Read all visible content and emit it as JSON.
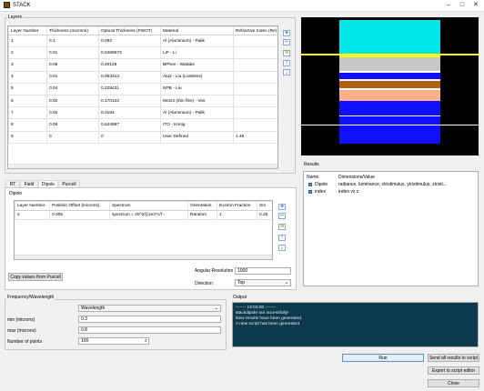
{
  "window": {
    "title": "STACK",
    "minimize_icon": "minimize-icon",
    "maximize_icon": "maximize-icon",
    "close_icon": "close-icon"
  },
  "layers": {
    "title": "Layers",
    "columns": [
      "Layer Number",
      "Thickness (microns)",
      "Optical Thickness (FWOT)",
      "Material",
      "Refractive Index (Re)"
    ],
    "rows": [
      [
        "1",
        "0.1",
        "0.092",
        "Al (Aluminium) - Palik",
        ""
      ],
      [
        "2",
        "0.01",
        "0.0469573",
        "LiF - Li",
        ""
      ],
      [
        "3",
        "0.06",
        "0.40128",
        "BPhen - Watabe",
        ""
      ],
      [
        "4",
        "0.01",
        "0.063313",
        "Alq3 - Liu (Lossless)",
        ""
      ],
      [
        "5",
        "0.04",
        "0.228431",
        "NPB - Liu",
        ""
      ],
      [
        "6",
        "0.02",
        "0.170122",
        "MoO3 (thin film) - Vos",
        ""
      ],
      [
        "7",
        "0.02",
        "0.0184",
        "Al (Aluminium) - Palik",
        ""
      ],
      [
        "8",
        "0.08",
        "0.624897",
        "ITO - Konig",
        ""
      ],
      [
        "9",
        "0",
        "0",
        "User Defined",
        "1.46"
      ]
    ]
  },
  "tabs": [
    {
      "label": "RT"
    },
    {
      "label": "Field"
    },
    {
      "label": "Dipole"
    },
    {
      "label": "Purcell"
    }
  ],
  "dipole": {
    "title": "Dipole",
    "columns": [
      "Layer Number",
      "Position Offset (microns)",
      "Spectrum",
      "Orientation",
      "Exciton Fraction",
      "Sm"
    ],
    "rows": [
      [
        "4",
        "0.005",
        "spectrum = 20^2/((1e3*c/f -",
        "Random",
        "1",
        "0.25"
      ]
    ],
    "copy_button": "Copy values from Purcell",
    "angular_resolution_label": "Angular Resolution",
    "angular_resolution_value": "1000",
    "direction_label": "Direction",
    "direction_value": "Top"
  },
  "results": {
    "title": "Results",
    "columns": [
      "Name",
      "Dimensions/Value"
    ],
    "rows": [
      {
        "name": "Dipole",
        "value": "radiance, luminance, xtristimulus, ytristimulus, ztristi..."
      },
      {
        "name": "index",
        "value": "index vs z"
      }
    ]
  },
  "frequency": {
    "title": "Frequency/Wavelength",
    "mode": "Wavelength",
    "min_label": "min (microns)",
    "min_value": "0.3",
    "max_label": "max (microns)",
    "max_value": "0.8",
    "points_label": "Number of points",
    "points_value": "100"
  },
  "output": {
    "title": "Output",
    "lines": [
      "------- 13:03:00 -------",
      "stackdipole ran sucessfully!",
      "New results have been generated.",
      "A new script has been generated."
    ]
  },
  "buttons": {
    "run": "Run",
    "send": "Send all results to script",
    "export": "Export to script editor",
    "close": "Close"
  },
  "stack_view": {
    "bands": [
      {
        "color": "#000000",
        "h": 3
      },
      {
        "color": "#00e5e5",
        "h": 38
      },
      {
        "color": "#ffff00",
        "h": 3
      },
      {
        "color": "#c8c8c8",
        "h": 15
      },
      {
        "color": "#ffffff",
        "h": 2
      },
      {
        "color": "#1010ff",
        "h": 7
      },
      {
        "color": "#ffffff",
        "h": 2
      },
      {
        "color": "#b06010",
        "h": 8
      },
      {
        "color": "#ffffff",
        "h": 2
      },
      {
        "color": "#ffb08a",
        "h": 12
      },
      {
        "color": "#1010ff",
        "h": 16
      },
      {
        "color": "#ffffff",
        "h": 1
      },
      {
        "color": "#1010ff",
        "h": 30
      },
      {
        "color": "#000000",
        "h": 2
      }
    ]
  }
}
